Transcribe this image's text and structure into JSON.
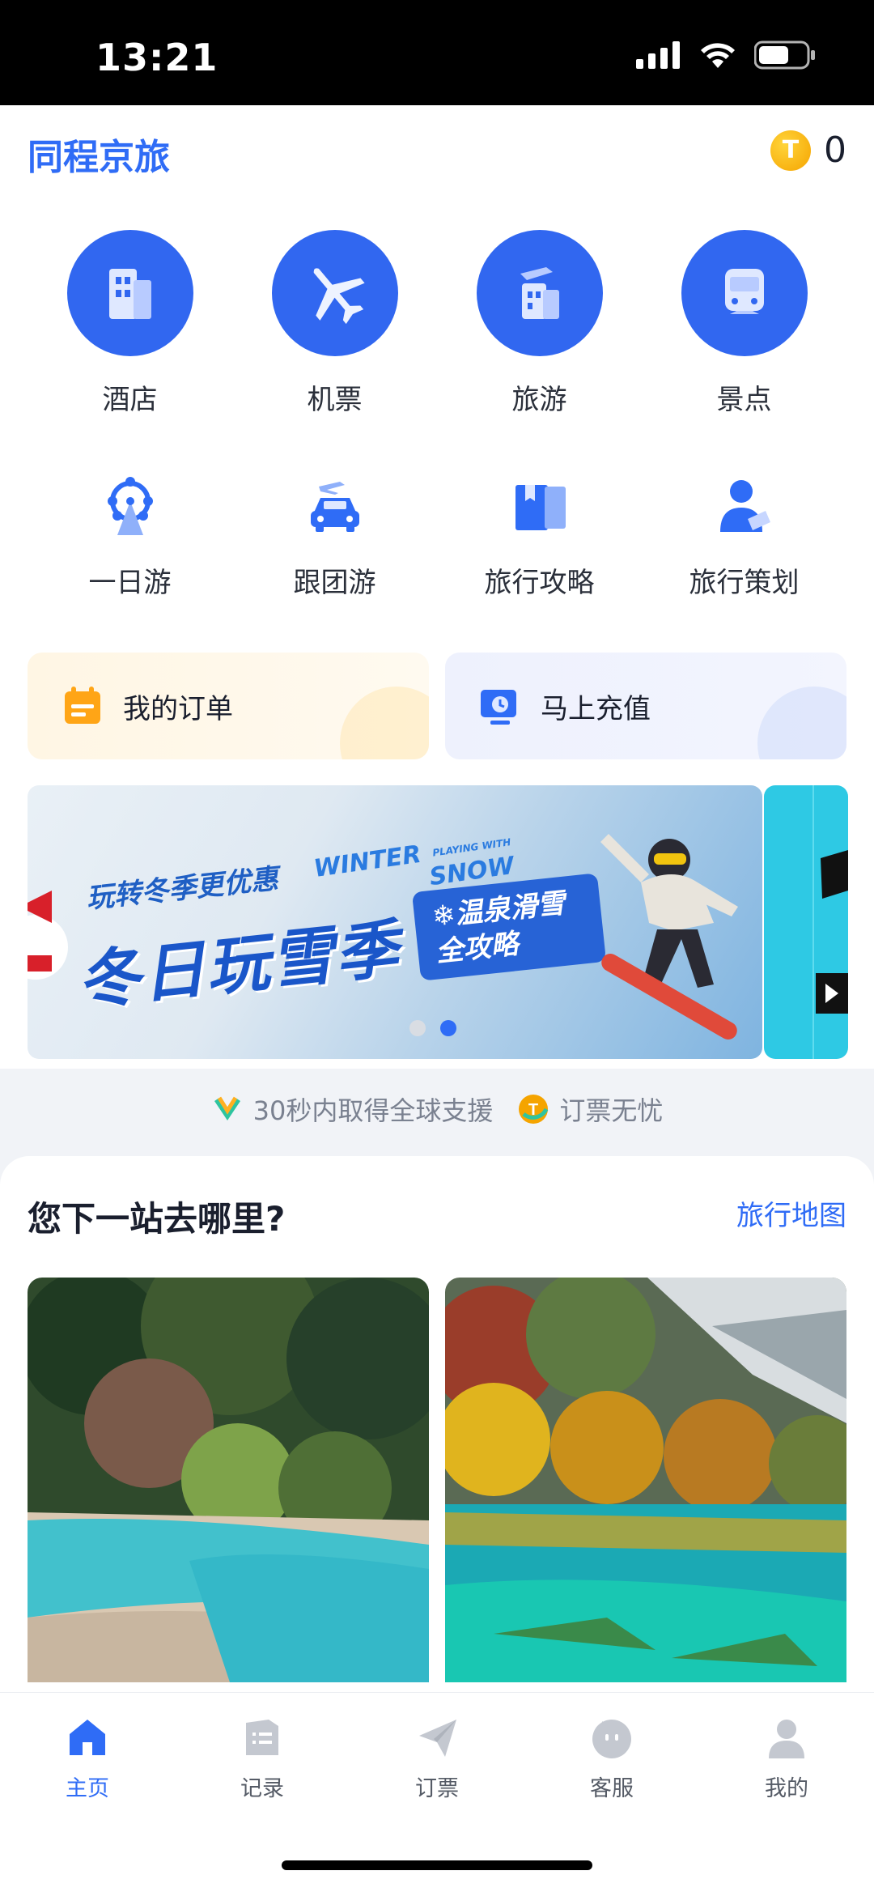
{
  "status": {
    "time": "13:21"
  },
  "header": {
    "app_title": "同程京旅",
    "coin_icon": "T",
    "coin_count": "0"
  },
  "main_services": [
    {
      "label": "酒店",
      "icon": "hotel-icon"
    },
    {
      "label": "机票",
      "icon": "plane-icon"
    },
    {
      "label": "旅游",
      "icon": "travel-icon"
    },
    {
      "label": "景点",
      "icon": "train-icon"
    }
  ],
  "sub_services": [
    {
      "label": "一日游",
      "icon": "ferris-wheel-icon"
    },
    {
      "label": "跟团游",
      "icon": "car-plane-icon"
    },
    {
      "label": "旅行攻略",
      "icon": "guide-book-icon"
    },
    {
      "label": "旅行策划",
      "icon": "planner-person-icon"
    }
  ],
  "cards": {
    "orders": "我的订单",
    "recharge": "马上充值"
  },
  "banner": {
    "subtitle": "玩转冬季更优惠",
    "title": "冬日玩雪季",
    "english_line1": "WINTER",
    "english_small": "PLAYING WITH",
    "english_line2": "SNOW",
    "tag_line1": "❄温泉滑雪",
    "tag_line2": "全攻略",
    "active_slide": 2,
    "slide_count": 2
  },
  "assurance": {
    "item1": "30秒内取得全球支援",
    "item2": "订票无忧"
  },
  "destinations": {
    "title": "您下一站去哪里?",
    "map_link": "旅行地图"
  },
  "tabs": [
    {
      "label": "主页",
      "icon": "home-icon",
      "active": true
    },
    {
      "label": "记录",
      "icon": "records-icon",
      "active": false
    },
    {
      "label": "订票",
      "icon": "paper-plane-icon",
      "active": false
    },
    {
      "label": "客服",
      "icon": "service-icon",
      "active": false
    },
    {
      "label": "我的",
      "icon": "profile-icon",
      "active": false
    }
  ],
  "colors": {
    "accent": "#2f6cf6",
    "coin": "#f5a400"
  }
}
